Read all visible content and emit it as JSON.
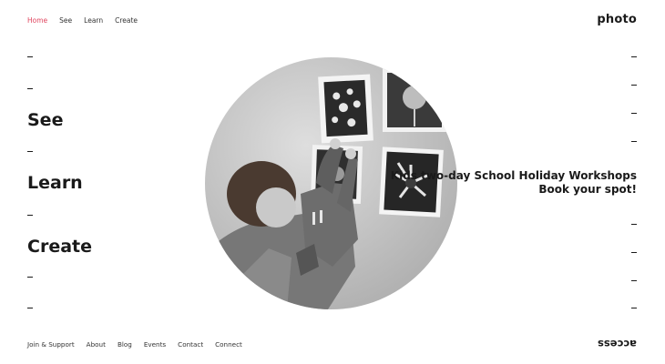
{
  "topnav": {
    "items": [
      "Home",
      "See",
      "Learn",
      "Create"
    ],
    "active": "Home"
  },
  "brand": "photo",
  "big_nav": {
    "see": "See",
    "learn": "Learn",
    "create": "Create"
  },
  "promo": {
    "line1": "Kids two-day School Holiday Workshops",
    "line2": "Book your spot!"
  },
  "footer": {
    "items": [
      "Join & Support",
      "About",
      "Blog",
      "Events",
      "Contact",
      "Connect"
    ]
  },
  "access_label": "access",
  "hero_image": {
    "alt": "Child pinning photographs to a wall"
  },
  "colors": {
    "accent": "#e0455f",
    "text": "#1a1a1a"
  }
}
